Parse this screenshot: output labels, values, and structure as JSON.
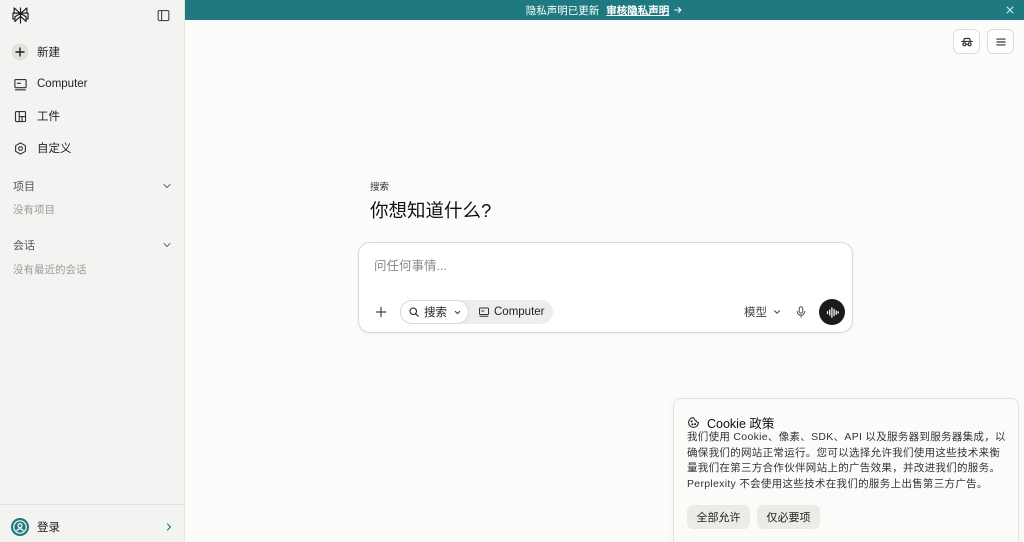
{
  "banner": {
    "text": "隐私声明已更新",
    "link_label": "审核隐私声明"
  },
  "sidebar": {
    "nav": [
      {
        "label": "新建",
        "icon": "plus-circle-icon"
      },
      {
        "label": "Computer",
        "icon": "monitor-icon"
      },
      {
        "label": "工件",
        "icon": "artifact-icon"
      },
      {
        "label": "自定义",
        "icon": "customize-icon"
      }
    ],
    "sections": [
      {
        "title": "项目",
        "empty_text": "没有项目"
      },
      {
        "title": "会话",
        "empty_text": "没有最近的会话"
      }
    ],
    "login_label": "登录"
  },
  "main": {
    "label": "搜索",
    "heading": "你想知道什么?",
    "input": {
      "placeholder": "问任何事情...",
      "value": ""
    },
    "mode_search": "搜索",
    "mode_computer": "Computer",
    "model_label": "模型"
  },
  "cookie": {
    "title": "Cookie 政策",
    "body": "我们使用 Cookie、像素、SDK、API 以及服务器到服务器集成，以确保我们的网站正常运行。您可以选择允许我们使用这些技术来衡量我们在第三方合作伙伴网站上的广告效果，并改进我们的服务。Perplexity 不会使用这些技术在我们的服务上出售第三方广告。",
    "allow_all": "全部允许",
    "necessary_only": "仅必要项"
  },
  "colors": {
    "accent": "#1e7a80",
    "sidebar_bg": "#f3f3f1",
    "page_bg": "#fcfcfa",
    "voice_button": "#1b1b1b"
  }
}
